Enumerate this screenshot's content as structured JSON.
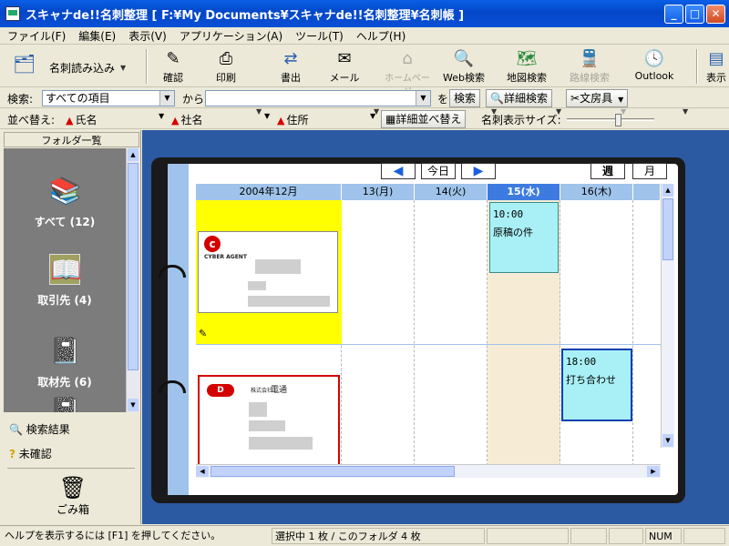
{
  "window": {
    "title": "スキャナde!!名刺整理 [ F:¥My Documents¥スキャナde!!名刺整理¥名刺帳 ]",
    "minimize": "_",
    "maximize": "□",
    "close": "✕"
  },
  "menu": [
    "ファイル(F)",
    "編集(E)",
    "表示(V)",
    "アプリケーション(A)",
    "ツール(T)",
    "ヘルプ(H)"
  ],
  "toolbar": {
    "scan_label": "名刺読み込み",
    "confirm": "確認",
    "print": "印刷",
    "export": "書出",
    "mail": "メール",
    "homepage": "ホームページ",
    "web_search": "Web検索",
    "map_search": "地図検索",
    "route_search": "路線検索",
    "outlook": "Outlook",
    "display": "表示"
  },
  "search": {
    "label": "検索:",
    "field": "すべての項目",
    "from": "から",
    "query": "",
    "wo": "を",
    "search_btn": "検索",
    "detail_btn": "詳細検索",
    "stationery_btn": "文房具"
  },
  "sort": {
    "label": "並べ替え:",
    "keys": [
      "氏名",
      "社名",
      "住所"
    ],
    "detail_btn": "詳細並べ替え",
    "size_label": "名刺表示サイズ:",
    "size_value": 0.6
  },
  "sidebar": {
    "header": "フォルダ一覧",
    "folders": [
      {
        "label": "すべて (12)",
        "icon": "books-icon"
      },
      {
        "label": "取引先 (4)",
        "icon": "open-book-icon"
      },
      {
        "label": "取材先 (6)",
        "icon": "black-book-icon"
      }
    ],
    "search_results": "検索結果",
    "unconfirmed": "未確認",
    "trash": "ごみ箱"
  },
  "calendar": {
    "today_btn": "今日",
    "week_btn": "週",
    "month_btn": "月",
    "month_header": "2004年12月",
    "days": [
      {
        "label": "13(月)",
        "today": false
      },
      {
        "label": "14(火)",
        "today": false
      },
      {
        "label": "15(水)",
        "today": true
      },
      {
        "label": "16(木)",
        "today": false
      }
    ],
    "cards": [
      {
        "company_logo": "CYBER AGENT"
      },
      {
        "company_logo": "電通",
        "prefix": "株式会社"
      }
    ],
    "events": [
      {
        "time": "10:00",
        "title": "原稿の件"
      },
      {
        "time": "18:00",
        "title": "打ち合わせ"
      }
    ]
  },
  "status": {
    "help": "ヘルプを表示するには [F1] を押してください。",
    "selection": "選択中 1 枚 / このフォルダ 4 枚",
    "num": "NUM"
  },
  "colors": {
    "title_bar": "#0a4fd6",
    "today_header": "#3d7be0",
    "event_bg": "#a8f0f5",
    "highlight_yellow": "#ffff00",
    "card_red_border": "#d40000"
  }
}
